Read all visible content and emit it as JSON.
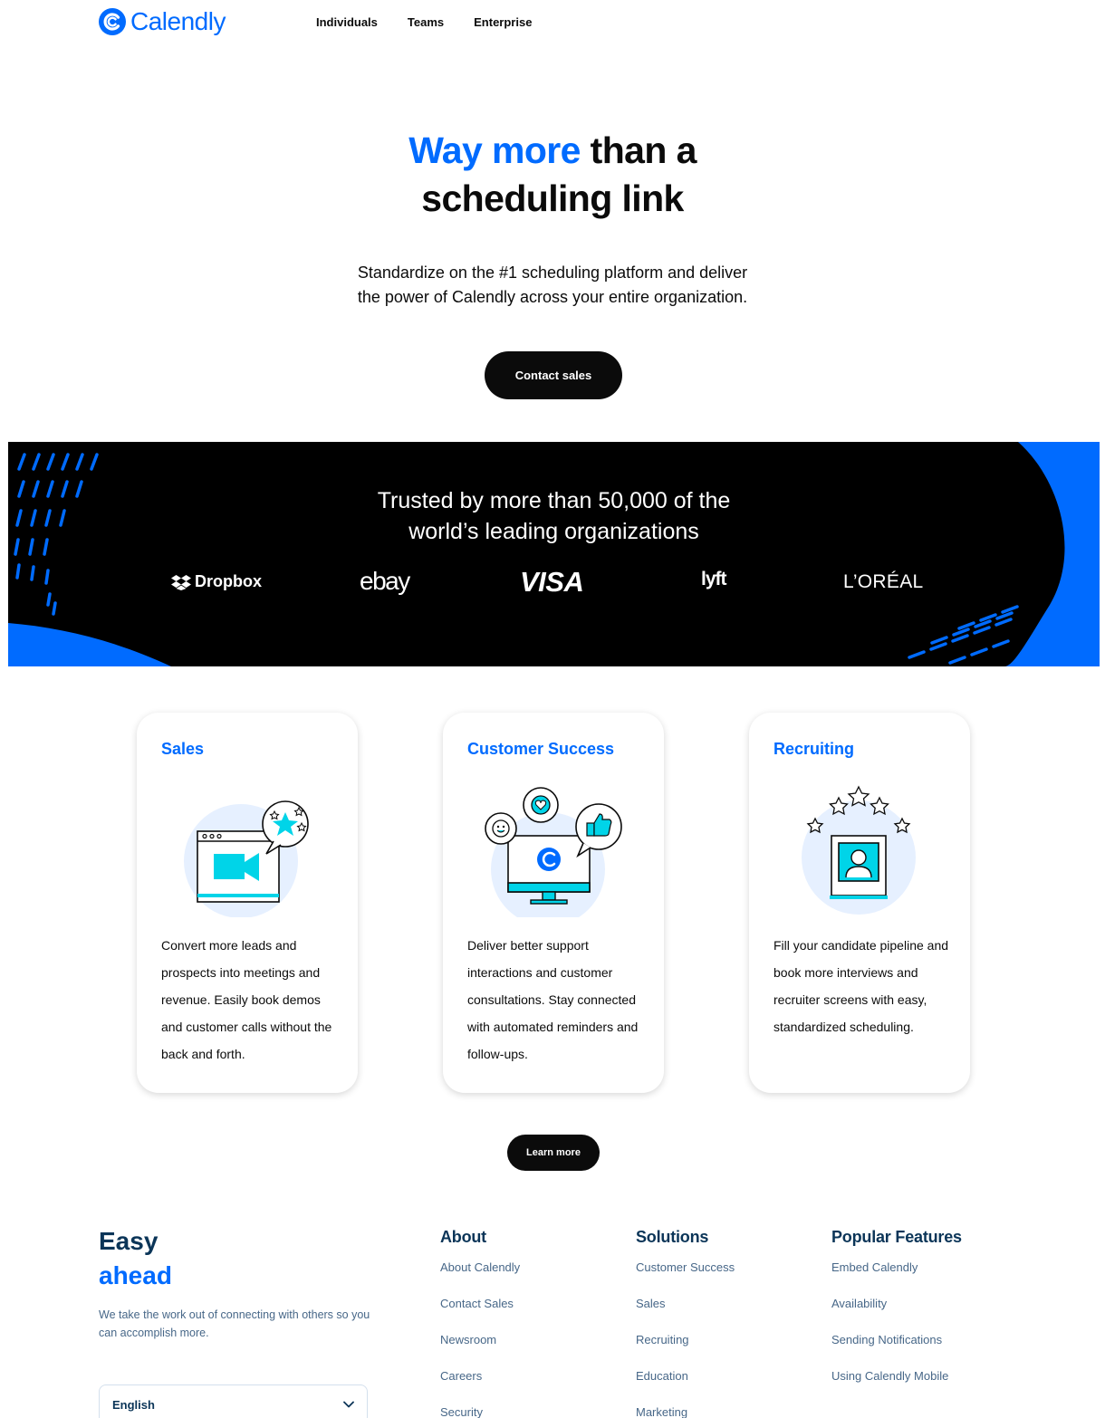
{
  "header": {
    "logo_text": "Calendly",
    "nav": [
      "Individuals",
      "Teams",
      "Enterprise"
    ]
  },
  "hero": {
    "title_accent": "Way more",
    "title_rest": " than a",
    "title_line2": "scheduling link",
    "subtitle": "Standardize on the #1 scheduling platform and deliver the power of Calendly across your entire organization.",
    "cta": "Contact sales"
  },
  "trusted": {
    "title_line1": "Trusted by more than 50,000 of the",
    "title_line2": "world’s leading organizations",
    "brands": [
      "Dropbox",
      "ebay",
      "VISA",
      "lyft",
      "L’ORÉAL"
    ]
  },
  "cards": [
    {
      "title": "Sales",
      "text": "Convert more leads and prospects into meetings and revenue. Easily book demos and customer calls without the back and forth.",
      "illustration": "video-call-icon"
    },
    {
      "title": "Customer Success",
      "text": "Deliver better support interactions and customer consultations. Stay connected with automated reminders and follow-ups.",
      "illustration": "monitor-feedback-icon"
    },
    {
      "title": "Recruiting",
      "text": "Fill your candidate pipeline and book more interviews and recruiter screens with easy, standardized scheduling.",
      "illustration": "candidate-profile-icon"
    }
  ],
  "learn_more": "Learn more",
  "footer": {
    "tagline_line1": "Easy",
    "tagline_line2": "ahead",
    "description": "We take the work out of connecting with others so you can accomplish more.",
    "language": "English",
    "columns": [
      {
        "heading": "About",
        "links": [
          "About Calendly",
          "Contact Sales",
          "Newsroom",
          "Careers",
          "Security"
        ]
      },
      {
        "heading": "Solutions",
        "links": [
          "Customer Success",
          "Sales",
          "Recruiting",
          "Education",
          "Marketing"
        ]
      },
      {
        "heading": "Popular Features",
        "links": [
          "Embed Calendly",
          "Availability",
          "Sending Notifications",
          "Using Calendly Mobile"
        ]
      }
    ]
  },
  "colors": {
    "brand_blue": "#006bff",
    "dark": "#0b0b0b",
    "navy": "#0b3558",
    "slate": "#476788",
    "cyan": "#00d4e8"
  }
}
